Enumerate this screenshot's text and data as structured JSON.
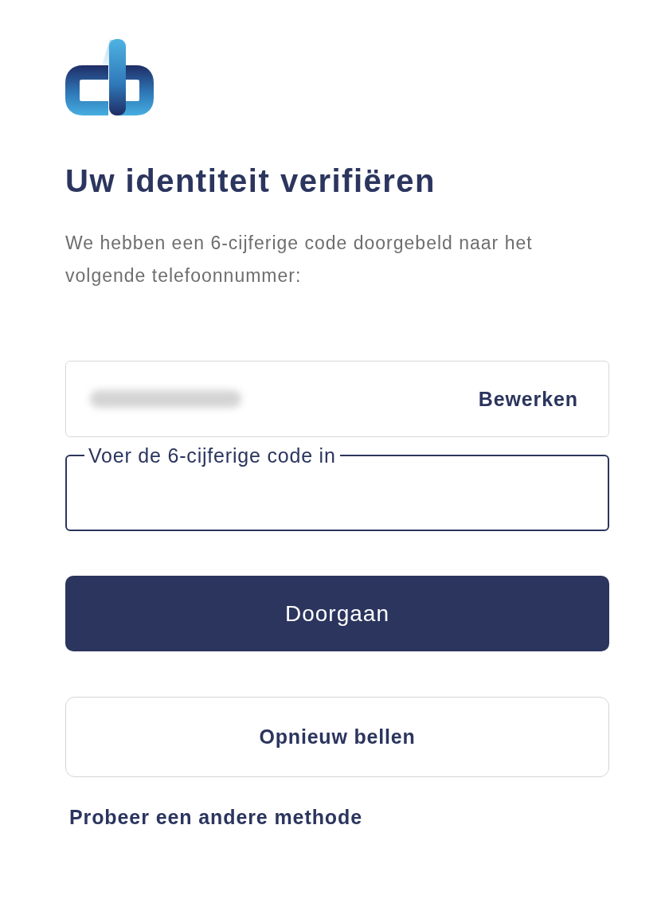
{
  "heading": "Uw identiteit verifiëren",
  "description": "We hebben een 6-cijferige code doorgebeld naar het volgende telefoonnummer:",
  "phone_field": {
    "edit_button": "Bewerken"
  },
  "code_field": {
    "label": "Voer de 6-cijferige code in",
    "focused": true
  },
  "buttons": [
    {
      "label": "Doorgaan",
      "kind": "primary"
    },
    {
      "label": "Opnieuw bellen",
      "kind": "secondary"
    }
  ],
  "link": "Probeer een andere methode"
}
